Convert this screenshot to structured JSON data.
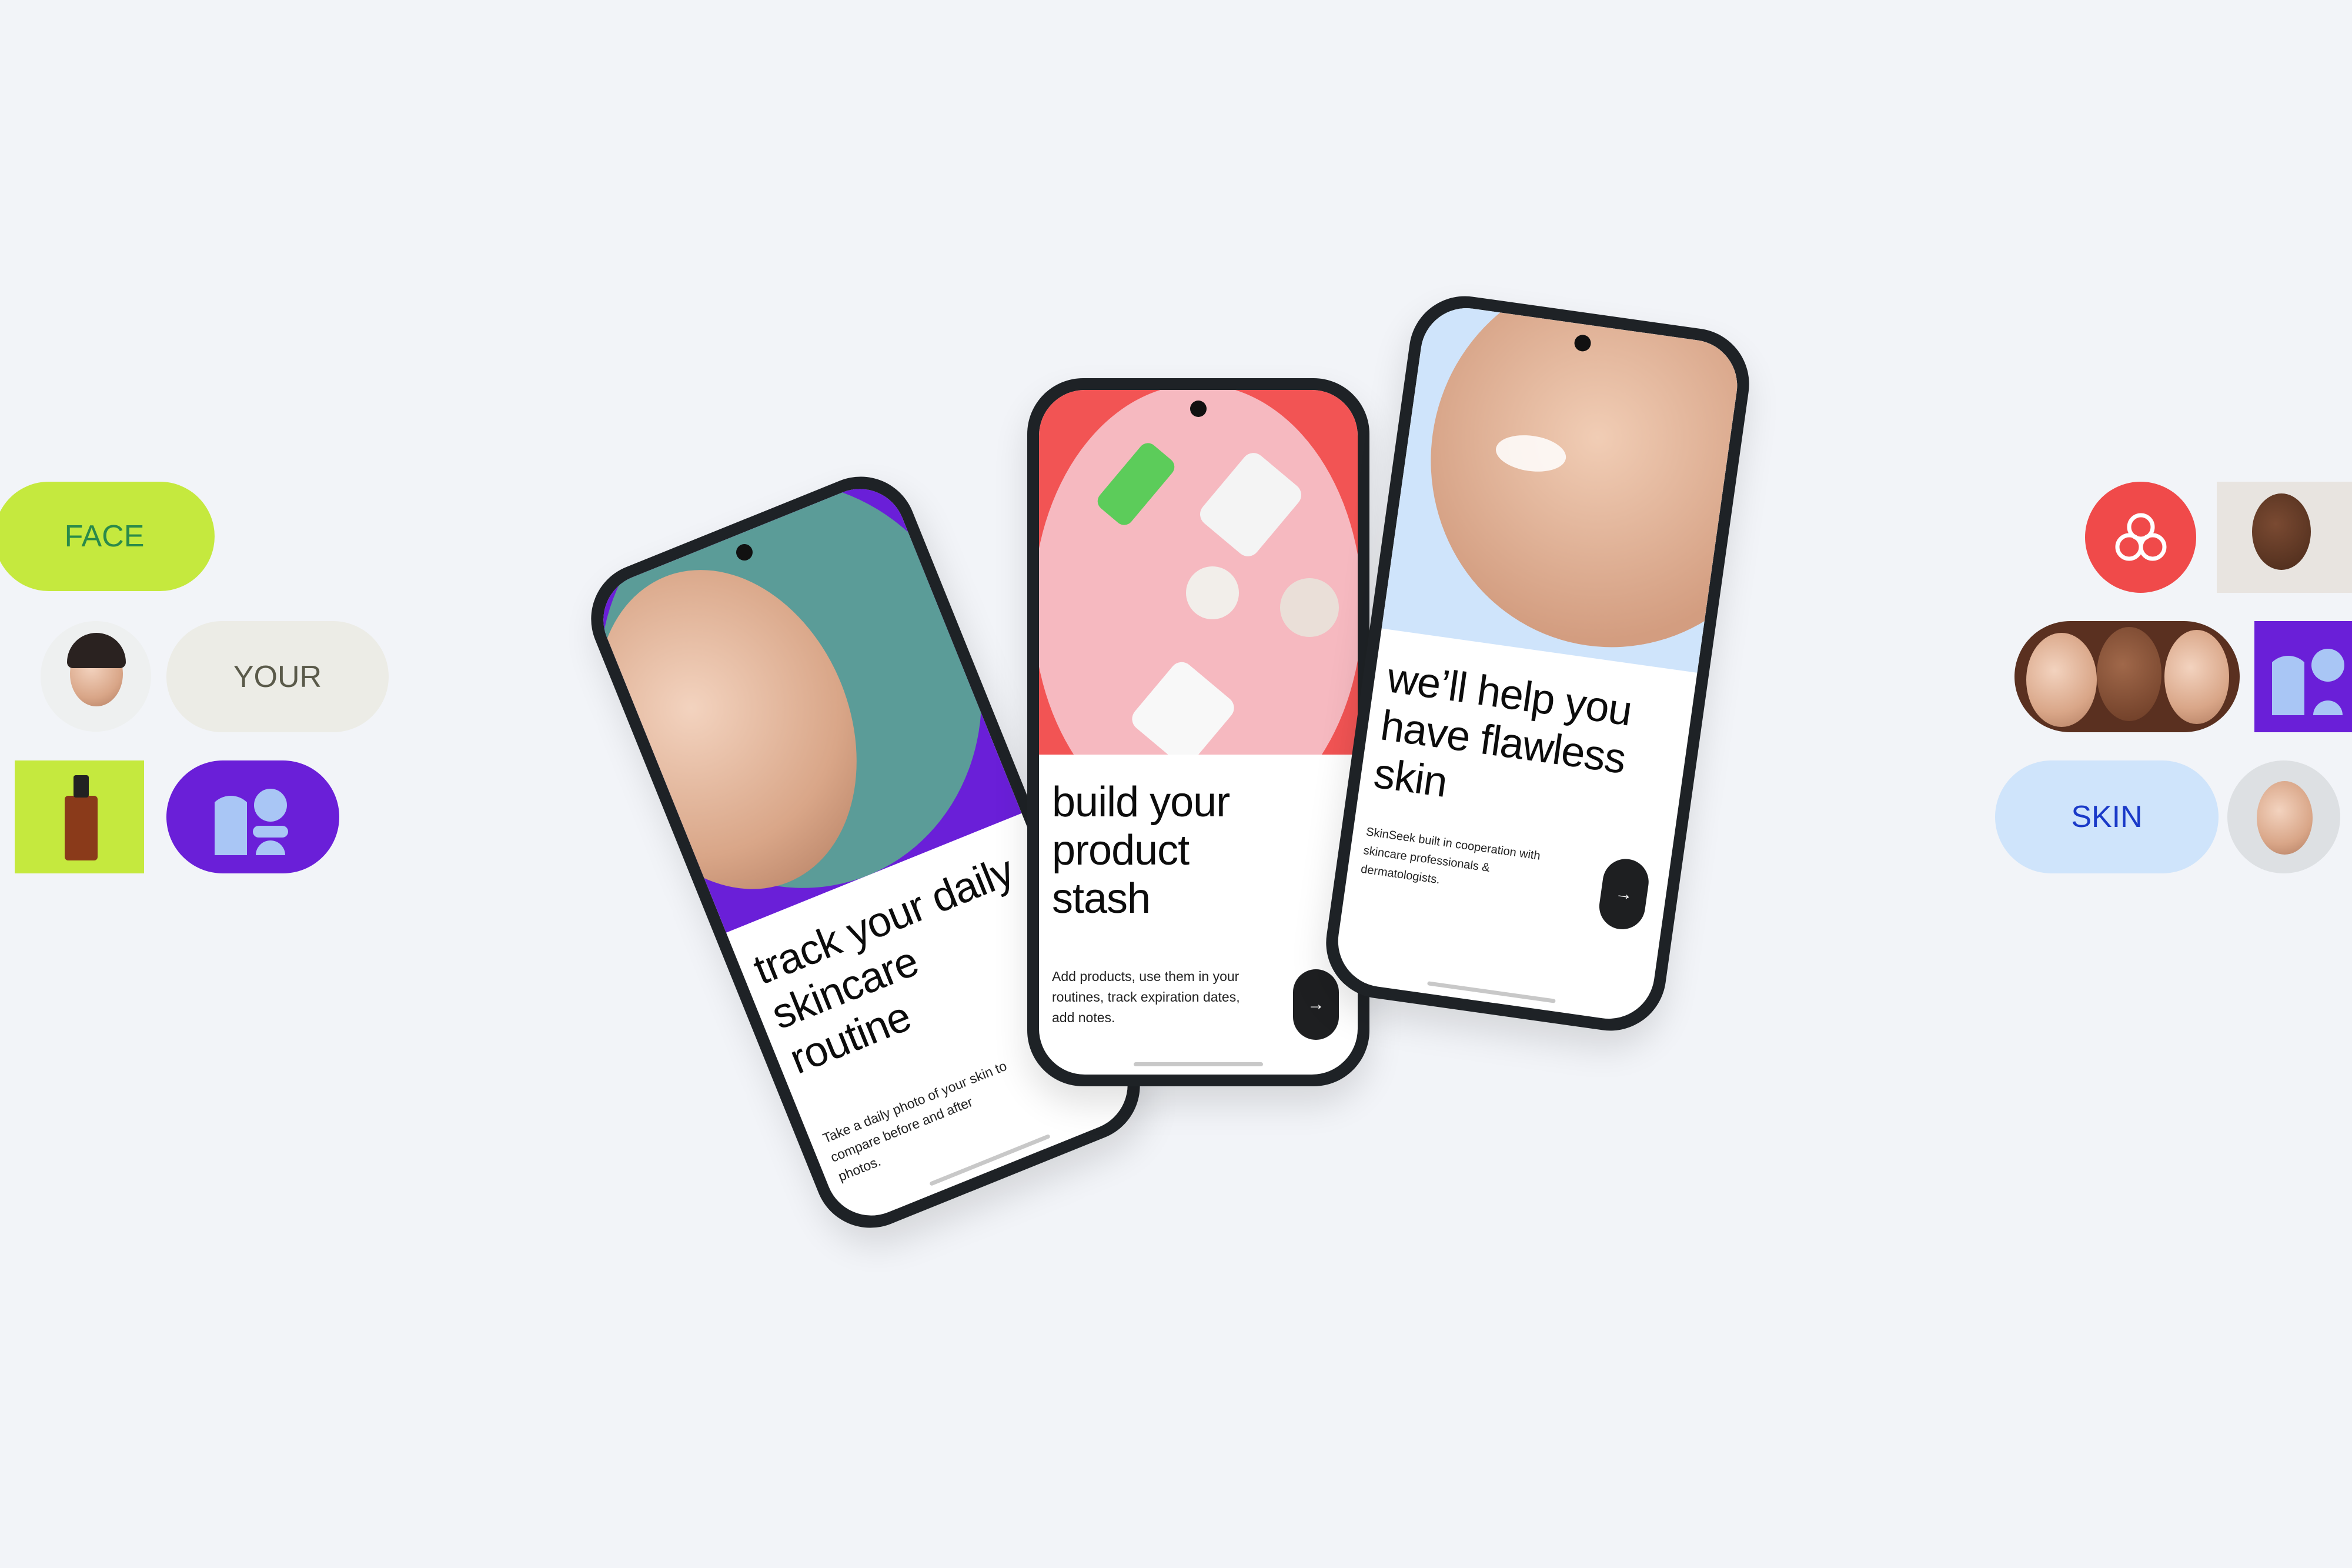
{
  "left_tiles": {
    "face_label": "FACE",
    "your_label": "YOUR"
  },
  "right_tiles": {
    "skin_label": "SKIN"
  },
  "phones": [
    {
      "headline": "track your daily skincare routine",
      "body": "Take a daily photo of your skin to compare before and after photos.",
      "next_icon": "→"
    },
    {
      "headline": "build your product stash",
      "body": "Add products, use them in your routines, track expiration dates, add notes.",
      "next_icon": "→"
    },
    {
      "headline": "we’ll help you have flawless skin",
      "body": "SkinSeek built in cooperation with skincare professionals & dermatologists.",
      "next_icon": "→"
    }
  ],
  "colors": {
    "background": "#f2f4f8",
    "lime": "#c5e93e",
    "purple": "#6a1fd8",
    "red": "#f04a4a",
    "sky": "#cfe4fb",
    "dark": "#1e2226"
  }
}
